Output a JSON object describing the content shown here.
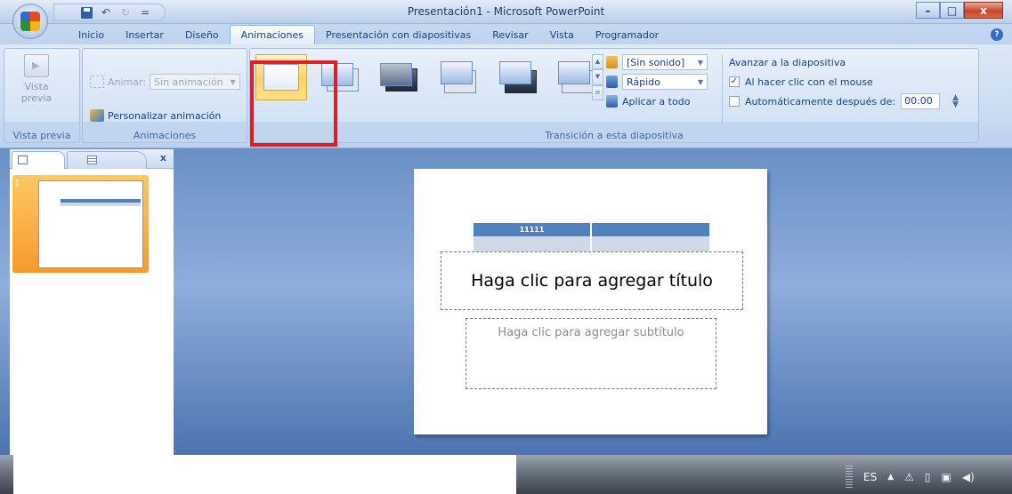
{
  "window": {
    "title": "Presentación1 - Microsoft PowerPoint",
    "minimize": "–",
    "maximize": "□",
    "close": "x"
  },
  "office_button": {
    "label": ""
  },
  "qat": {
    "undo": "↶",
    "redo": "↻",
    "customize": "="
  },
  "tabs": [
    {
      "label": "Inicio"
    },
    {
      "label": "Insertar"
    },
    {
      "label": "Diseño"
    },
    {
      "label": "Animaciones"
    },
    {
      "label": "Presentación con diapositivas"
    },
    {
      "label": "Revisar"
    },
    {
      "label": "Vista"
    },
    {
      "label": "Programador"
    }
  ],
  "active_tab": "Animaciones",
  "ribbon": {
    "preview": {
      "button": "Vista previa",
      "button_line1": "Vista",
      "button_line2": "previa",
      "group": "Vista previa"
    },
    "animations": {
      "animate_label": "Animar:",
      "animate_value": "Sin animación",
      "custom_animation": "Personalizar animación",
      "group": "Animaciones"
    },
    "transition": {
      "sound": "[Sin sonido]",
      "speed": "Rápido",
      "apply_all": "Aplicar a todo",
      "group": "Transición a esta diapositiva",
      "selected_index": 0
    },
    "advance": {
      "title": "Avanzar a la diapositiva",
      "on_click": "Al hacer clic con el mouse",
      "on_click_checked": true,
      "auto_after": "Automáticamente después de:",
      "auto_after_checked": false,
      "time": "00:00"
    }
  },
  "slides_pane": {
    "close": "x",
    "slide_number": "1",
    "thumb_cell": "11111"
  },
  "slide": {
    "table_header": "11111",
    "title_placeholder": "Haga clic para agregar título",
    "subtitle_placeholder": "Haga clic para agregar subtítulo"
  },
  "taskbar": {
    "language": "ES",
    "tray_up": "▲"
  },
  "colors": {
    "highlight": "#e21d25",
    "table_header": "#4f81bd",
    "table_body": "#d0d8e8",
    "ribbon": "#c9dbf1"
  }
}
